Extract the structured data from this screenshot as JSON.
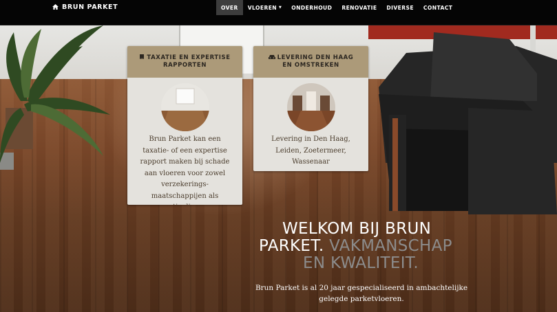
{
  "navbar": {
    "brand": "BRUN PARKET",
    "brand_icon": "home-icon",
    "items": [
      {
        "label": "OVER",
        "active": true
      },
      {
        "label": "VLOEREN",
        "dropdown": true
      },
      {
        "label": "ONDERHOUD"
      },
      {
        "label": "RENOVATIE"
      },
      {
        "label": "DIVERSE"
      },
      {
        "label": "CONTACT"
      }
    ]
  },
  "cards": [
    {
      "icon": "book-icon",
      "title": "TAXATIE EN EXPERTISE RAPPORTEN",
      "text": "Brun Parket kan een taxatie- of een expertise rapport maken bij schade aan vloeren voor zowel verzekerings-maatschappijen als particulieren."
    },
    {
      "icon": "car-icon",
      "title": "LEVERING DEN HAAG EN OMSTREKEN",
      "text": "Levering in Den Haag, Leiden, Zoetermeer, Wassenaar"
    }
  ],
  "welcome": {
    "line1": "WELKOM BIJ BRUN",
    "line2_main": "PARKET.",
    "line2_muted": "VAKMANSCHAP",
    "line3_muted": "EN KWALITEIT."
  },
  "intro": "Brun Parket is al 20 jaar gespecialiseerd in ambachtelijke gelegde parketvloeren.",
  "colors": {
    "navbar_bg": "#050505",
    "nav_active": "#3d3d3d",
    "card_header": "#ac9a79",
    "card_body": "#e4e2dd"
  }
}
